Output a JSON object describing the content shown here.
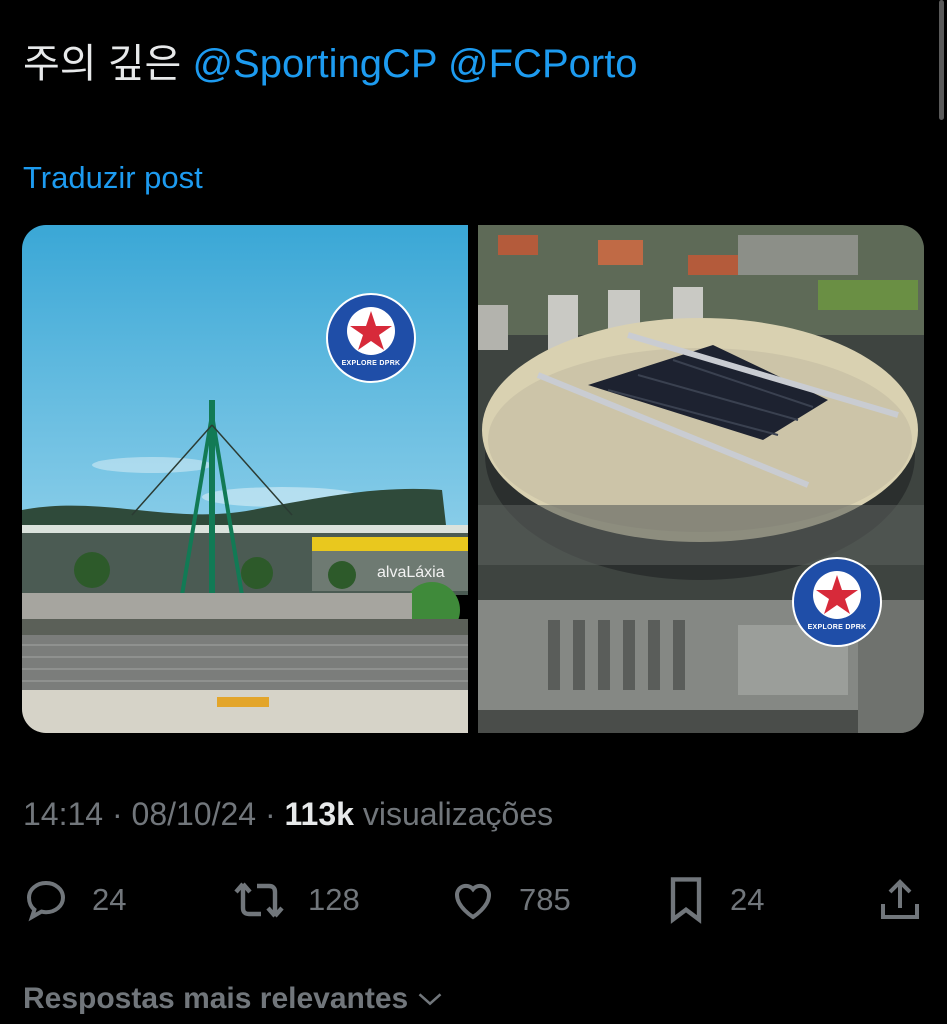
{
  "tweet": {
    "text_prefix": "주의 깊은",
    "mentions": [
      "@SportingCP",
      "@FCPorto"
    ],
    "translate_label": "Traduzir post"
  },
  "media": {
    "left_badge_text": "EXPLORE DPRK",
    "right_badge_text": "EXPLORE DPRK",
    "left_sign_text": "alvaLáxia"
  },
  "meta": {
    "time": "14:14",
    "date": "08/10/24",
    "views": "113k",
    "views_label": "visualizações"
  },
  "actions": {
    "replies": "24",
    "retweets": "128",
    "likes": "785",
    "bookmarks": "24",
    "icons": [
      "reply-icon",
      "retweet-icon",
      "like-icon",
      "bookmark-icon",
      "share-icon"
    ]
  },
  "footer": {
    "sort_label": "Respostas mais relevantes"
  },
  "colors": {
    "accent": "#1d9bf0",
    "muted": "#71767b",
    "text": "#e7e9ea",
    "background": "#000000"
  }
}
